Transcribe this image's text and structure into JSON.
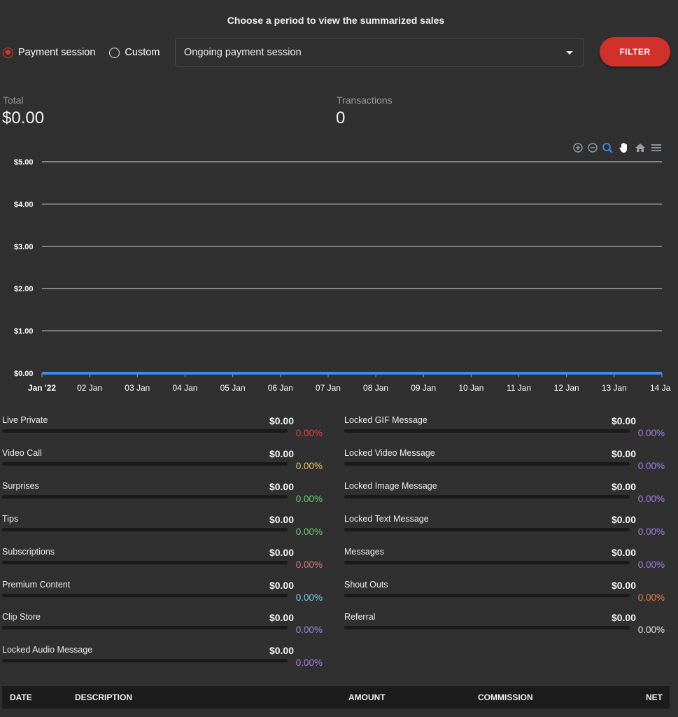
{
  "header": {
    "title": "Choose a period to view the summarized sales"
  },
  "period": {
    "options": [
      {
        "label": "Payment session",
        "checked": true
      },
      {
        "label": "Custom",
        "checked": false
      }
    ],
    "selected": "Ongoing payment session",
    "filter_label": "FILTER"
  },
  "stats": {
    "total_label": "Total",
    "total_value": "$0.00",
    "transactions_label": "Transactions",
    "transactions_value": "0"
  },
  "toolbar": {
    "icons": [
      "zoom-in-icon",
      "zoom-out-icon",
      "selection-zoom-icon",
      "pan-icon",
      "reset-zoom-icon",
      "menu-icon"
    ]
  },
  "chart_data": {
    "type": "line",
    "x": [
      "Jan '22",
      "02 Jan",
      "03 Jan",
      "04 Jan",
      "05 Jan",
      "06 Jan",
      "07 Jan",
      "08 Jan",
      "09 Jan",
      "10 Jan",
      "11 Jan",
      "12 Jan",
      "13 Jan",
      "14 Ja"
    ],
    "y_ticks": [
      "$5.00",
      "$4.00",
      "$3.00",
      "$2.00",
      "$1.00",
      "$0.00"
    ],
    "ylim": [
      0,
      5
    ],
    "series": [
      {
        "values": [
          0,
          0,
          0,
          0,
          0,
          0,
          0,
          0,
          0,
          0,
          0,
          0,
          0,
          0
        ]
      }
    ],
    "line_color": "#3b8eea",
    "grid": true
  },
  "categories_left": [
    {
      "label": "Live Private",
      "amount": "$0.00",
      "percent": "0.00%",
      "color": "#e0443e"
    },
    {
      "label": "Video Call",
      "amount": "$0.00",
      "percent": "0.00%",
      "color": "#e8c76a"
    },
    {
      "label": "Surprises",
      "amount": "$0.00",
      "percent": "0.00%",
      "color": "#6fcf72"
    },
    {
      "label": "Tips",
      "amount": "$0.00",
      "percent": "0.00%",
      "color": "#6fcf72"
    },
    {
      "label": "Subscriptions",
      "amount": "$0.00",
      "percent": "0.00%",
      "color": "#e07a74"
    },
    {
      "label": "Premium Content",
      "amount": "$0.00",
      "percent": "0.00%",
      "color": "#7ad0e8"
    },
    {
      "label": "Clip Store",
      "amount": "$0.00",
      "percent": "0.00%",
      "color": "#9b8de8"
    },
    {
      "label": "Locked Audio Message",
      "amount": "$0.00",
      "percent": "0.00%",
      "color": "#a97de6"
    }
  ],
  "categories_right": [
    {
      "label": "Locked GIF Message",
      "amount": "$0.00",
      "percent": "0.00%",
      "color": "#a97de6"
    },
    {
      "label": "Locked Video Message",
      "amount": "$0.00",
      "percent": "0.00%",
      "color": "#a97de6"
    },
    {
      "label": "Locked Image Message",
      "amount": "$0.00",
      "percent": "0.00%",
      "color": "#a97de6"
    },
    {
      "label": "Locked Text Message",
      "amount": "$0.00",
      "percent": "0.00%",
      "color": "#a97de6"
    },
    {
      "label": "Messages",
      "amount": "$0.00",
      "percent": "0.00%",
      "color": "#a97de6"
    },
    {
      "label": "Shout Outs",
      "amount": "$0.00",
      "percent": "0.00%",
      "color": "#e8823d"
    },
    {
      "label": "Referral",
      "amount": "$0.00",
      "percent": "0.00%",
      "color": "#e8e8e8"
    }
  ],
  "table": {
    "columns": [
      "DATE",
      "DESCRIPTION",
      "AMOUNT",
      "COMMISSION",
      "NET"
    ]
  }
}
